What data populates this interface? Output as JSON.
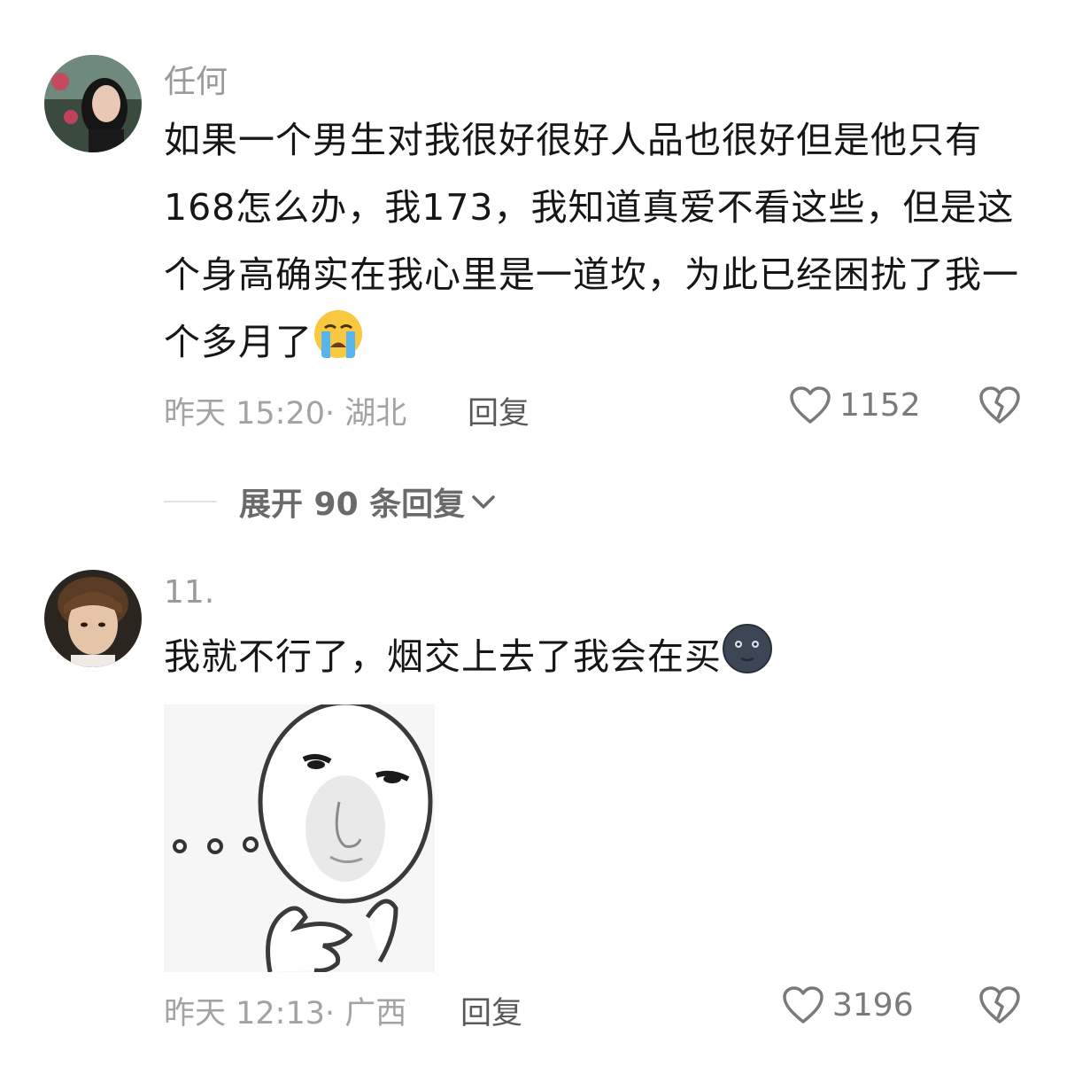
{
  "comments": [
    {
      "username": "任何",
      "text": "如果一个男生对我很好很好人品也很好但是他只有168怎么办，我173，我知道真爱不看这些，但是这个身高确实在我心里是一道坎，为此已经困扰了我一个多月了",
      "emoji": "crying-face-emoji",
      "time": "昨天 15:20",
      "location": "· 湖北",
      "reply_label": "回复",
      "likes": "1152"
    },
    {
      "username": "11.",
      "text": "我就不行了，烟交上去了我会在买",
      "emoji": "new-moon-face-emoji",
      "time": "昨天 12:13",
      "location": "· 广西",
      "reply_label": "回复",
      "likes": "3196"
    }
  ],
  "expand_replies": {
    "label": "展开 90 条回复"
  },
  "icons": {
    "like": "heart-outline-icon",
    "dislike": "broken-heart-icon",
    "expand": "chevron-down-icon"
  }
}
